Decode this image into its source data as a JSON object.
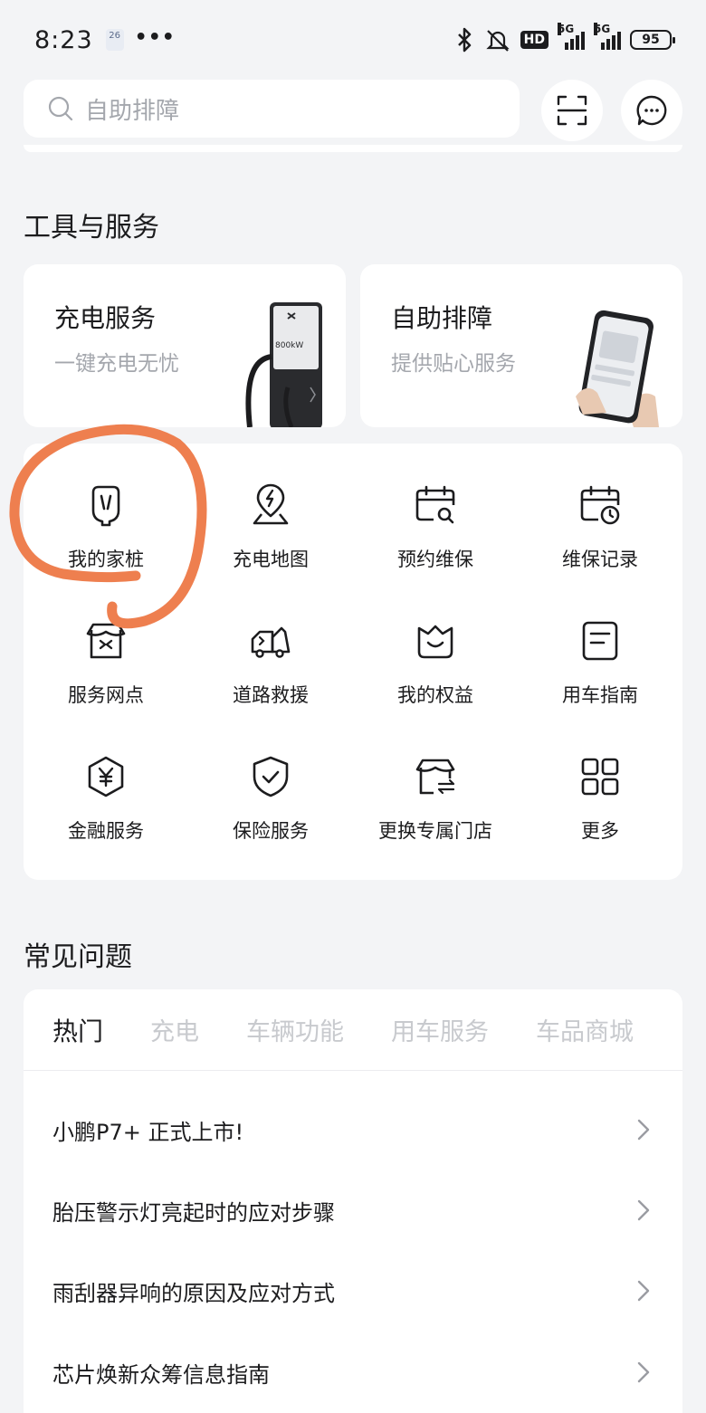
{
  "status_bar": {
    "time": "8:23",
    "badge": "26",
    "more": "•••",
    "hd": "HD",
    "net1": "5G",
    "net2": "5G",
    "battery": "95"
  },
  "search": {
    "placeholder": "自助排障"
  },
  "tools": {
    "title": "工具与服务",
    "cards": [
      {
        "title": "充电服务",
        "subtitle": "一键充电无忧",
        "image_text": "800kW"
      },
      {
        "title": "自助排障",
        "subtitle": "提供贴心服务"
      }
    ],
    "items": [
      {
        "label": "我的家桩",
        "icon": "home-charger-icon"
      },
      {
        "label": "充电地图",
        "icon": "charging-map-icon"
      },
      {
        "label": "预约维保",
        "icon": "calendar-search-icon"
      },
      {
        "label": "维保记录",
        "icon": "calendar-clock-icon"
      },
      {
        "label": "服务网点",
        "icon": "service-store-icon"
      },
      {
        "label": "道路救援",
        "icon": "tow-truck-icon"
      },
      {
        "label": "我的权益",
        "icon": "benefits-basket-icon"
      },
      {
        "label": "用车指南",
        "icon": "guide-document-icon"
      },
      {
        "label": "金融服务",
        "icon": "yuan-shield-icon"
      },
      {
        "label": "保险服务",
        "icon": "check-shield-icon"
      },
      {
        "label": "更换专属门店",
        "icon": "store-switch-icon"
      },
      {
        "label": "更多",
        "icon": "grid-more-icon"
      }
    ]
  },
  "faq": {
    "title": "常见问题",
    "tabs": [
      "热门",
      "充电",
      "车辆功能",
      "用车服务",
      "车品商城"
    ],
    "questions": [
      "小鹏P7+ 正式上市!",
      "胎压警示灯亮起时的应对步骤",
      "雨刮器异响的原因及应对方式",
      "芯片焕新众筹信息指南"
    ]
  },
  "colors": {
    "background": "#f3f4f6",
    "card": "#ffffff",
    "text": "#1c1c1e",
    "muted": "#a4a7ad",
    "annotation": "#ee7f4f"
  }
}
